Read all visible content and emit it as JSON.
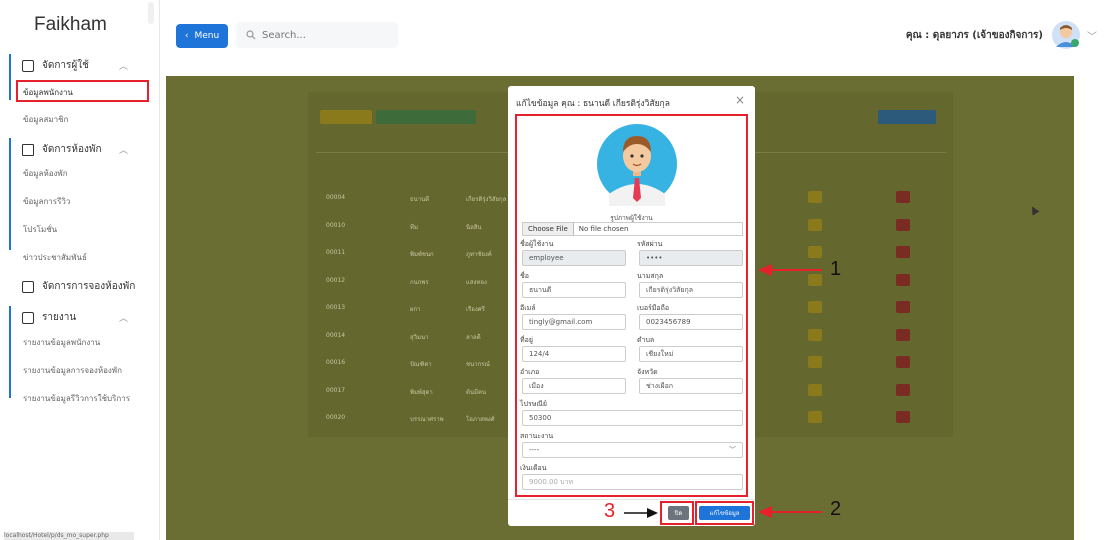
{
  "app": {
    "logo": "Faikham"
  },
  "sidebar": {
    "sections": [
      {
        "label": "จัดการผู้ใช้",
        "items": [
          "ข้อมูลพนักงาน",
          "ข้อมูลสมาชิก"
        ]
      },
      {
        "label": "จัดการห้องพัก",
        "items": [
          "ข้อมูลห้องพัก",
          "ข้อมูลการรีวิว",
          "โปรโมชั่น",
          "ข่าวประชาสัมพันธ์"
        ]
      },
      {
        "label": "จัดการการจองห้องพัก",
        "items": []
      },
      {
        "label": "รายงาน",
        "items": [
          "รายงานข้อมูลพนักงาน",
          "รายงานข้อมูลการจองห้องพัก",
          "รายงานข้อมูลรีวิวการใช้บริการ"
        ]
      }
    ],
    "status_url": "localhost/Hotel/p/ds_mo_super.php"
  },
  "header": {
    "menu_label": "Menu",
    "search_placeholder": "Search...",
    "user_label": "คุณ : ดุลยาภร (เจ้าของกิจการ)"
  },
  "table": {
    "rows": [
      {
        "id": "00004",
        "name": "ธนานดี",
        "surname": "เกียรติรุ่งวิสัยกุล"
      },
      {
        "id": "00010",
        "name": "ทีม",
        "surname": "นิลสิน"
      },
      {
        "id": "00011",
        "name": "พิมพ์ชนก",
        "surname": "ภูทาชัยงค์"
      },
      {
        "id": "00012",
        "name": "กนกพร",
        "surname": "แสงทอง"
      },
      {
        "id": "00013",
        "name": "ผกา",
        "surname": "เรืองศรี"
      },
      {
        "id": "00014",
        "name": "สุวิมนา",
        "surname": "ลาลดี"
      },
      {
        "id": "00016",
        "name": "ปัณฑิตา",
        "surname": "ชนากรณ์"
      },
      {
        "id": "00017",
        "name": "พิมพ์สุดา",
        "surname": "ต้นมีคน"
      },
      {
        "id": "00020",
        "name": "บรรณาศราพ",
        "surname": "โอภาสพงศ์"
      }
    ]
  },
  "modal": {
    "title": "แก้ไขข้อมูล คุณ : ธนานดี เกียรติรุ่งวิสัยกุล",
    "photo_caption": "รูปภาพผู้ใช้งาน",
    "file_button": "Choose File",
    "file_status": "No file chosen",
    "fields": {
      "username": {
        "label": "ชื่อผู้ใช้งาน",
        "value": "employee"
      },
      "password": {
        "label": "รหัสผ่าน",
        "value": "••••"
      },
      "first_name": {
        "label": "ชื่อ",
        "value": "ธนานดี"
      },
      "last_name": {
        "label": "นามสกุล",
        "value": "เกียรติรุ่งวิสัยกุล"
      },
      "email": {
        "label": "อีเมล์",
        "value": "tingly@gmail.com"
      },
      "phone": {
        "label": "เบอร์มือถือ",
        "value": "0023456789"
      },
      "address": {
        "label": "ที่อยู่",
        "value": "124/4"
      },
      "subdistrict": {
        "label": "ตำบล",
        "value": "เชียงใหม่"
      },
      "district": {
        "label": "อำเภอ",
        "value": "เมือง"
      },
      "province": {
        "label": "จังหวัด",
        "value": "ช่างเผือก"
      },
      "postcode": {
        "label": "ไปรษณีย์",
        "value": "50300"
      },
      "status": {
        "label": "สถานะงาน",
        "value": "----"
      },
      "salary": {
        "label": "เงินเดือน",
        "value": "9000.00 บาท"
      }
    },
    "close_label": "ปิด",
    "save_label": "แก้ไขข้อมูล"
  },
  "annotations": {
    "one": "1",
    "two": "2",
    "three": "3"
  },
  "colors": {
    "primary": "#1e74d8",
    "highlight": "#e6202c",
    "overlay": "#6b6e33"
  }
}
